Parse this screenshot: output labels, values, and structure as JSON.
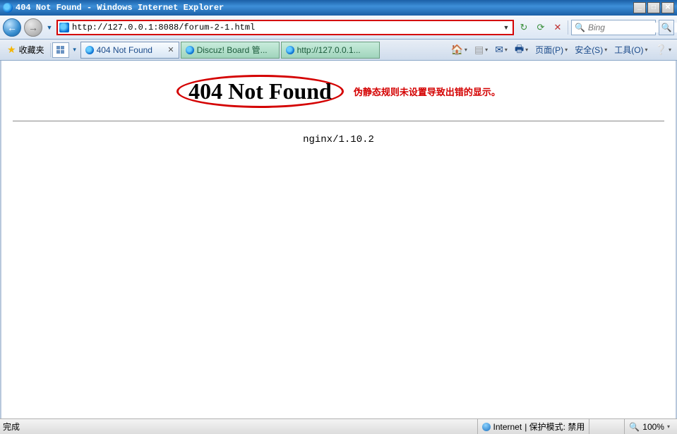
{
  "window": {
    "title": "404 Not Found - Windows Internet Explorer"
  },
  "address_bar": {
    "url": "http://127.0.0.1:8088/forum-2-1.html"
  },
  "search": {
    "placeholder": "Bing"
  },
  "favorites_label": "收藏夹",
  "tabs": [
    {
      "label": "404 Not Found",
      "active": true
    },
    {
      "label": "Discuz! Board 管...",
      "active": false
    },
    {
      "label": "http://127.0.0.1...",
      "active": false
    }
  ],
  "command_bar": {
    "page": "页面(P)",
    "safety": "安全(S)",
    "tools": "工具(O)"
  },
  "page_content": {
    "error_heading": "404 Not Found",
    "annotation": "伪静态规则未设置导致出错的显示。",
    "server_line": "nginx/1.10.2"
  },
  "statusbar": {
    "done": "完成",
    "zone": "Internet",
    "protected_mode": "| 保护模式: 禁用",
    "zoom": "100%"
  }
}
